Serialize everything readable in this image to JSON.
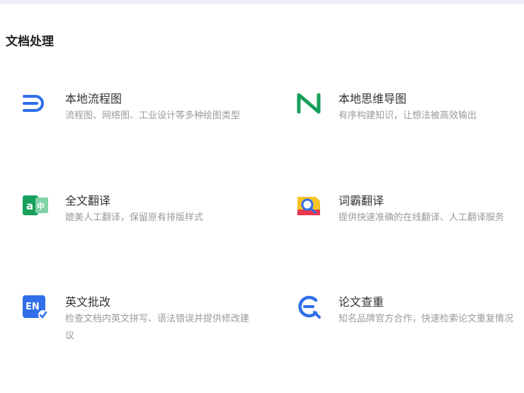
{
  "section": {
    "title": "文档处理"
  },
  "items": [
    {
      "name": "本地流程图",
      "desc": "流程图、网络图、工业设计等多种绘图类型",
      "icon": "flowchart-icon"
    },
    {
      "name": "本地思维导图",
      "desc": "有序构建知识，让想法被高效输出",
      "icon": "mindmap-icon"
    },
    {
      "name": "全文翻译",
      "desc": "媲美人工翻译，保留原有排版样式",
      "icon": "translate-icon"
    },
    {
      "name": "词霸翻译",
      "desc": "提供快速准确的在线翻译、人工翻译服务",
      "icon": "iciba-icon"
    },
    {
      "name": "英文批改",
      "desc": "检查文档内英文拼写、语法错误并提供修改建议",
      "icon": "english-check-icon"
    },
    {
      "name": "论文查重",
      "desc": "知名品牌官方合作，快速检索论文重复情况",
      "icon": "plagiarism-check-icon"
    }
  ],
  "colors": {
    "blue": "#2f6fea",
    "green": "#16a05c",
    "red": "#e8384f",
    "yellow": "#f7c325"
  }
}
